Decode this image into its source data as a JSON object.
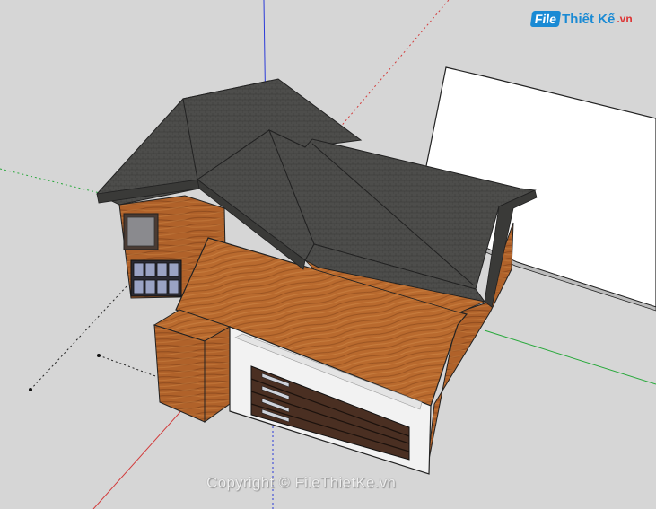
{
  "watermark": {
    "logo_file": "File",
    "logo_rest": "Thiết Kế",
    "logo_tld": ".vn",
    "copyright": "Copyright © FileThietKe.vn"
  },
  "colors": {
    "background": "#d6d6d6",
    "roof": "#4a4a48",
    "wood": "#b5652b",
    "trim_white": "#f2f2f2",
    "garage_door": "#4a2f22",
    "axis_red": "#d23b3b",
    "axis_green": "#27a83a",
    "axis_blue": "#2b3bd8"
  }
}
